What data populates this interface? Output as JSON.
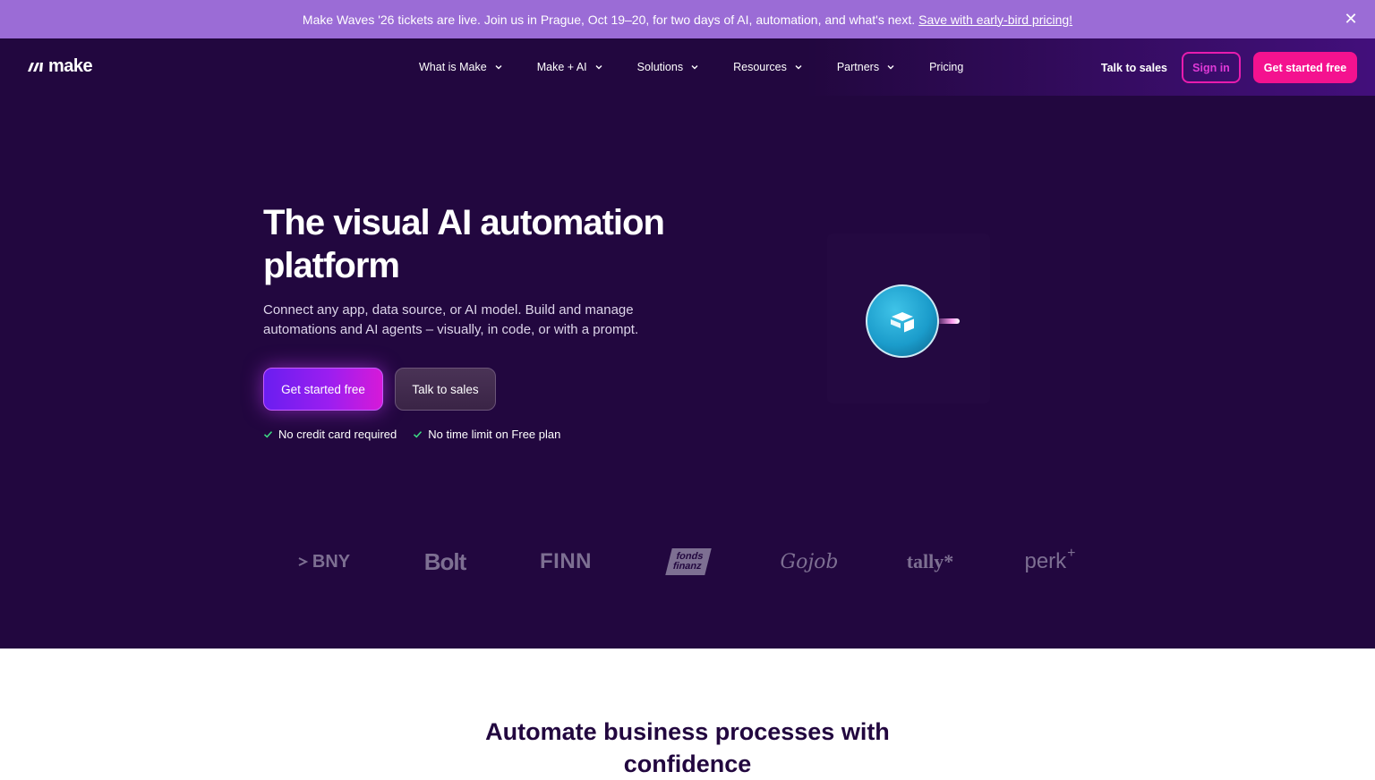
{
  "banner": {
    "text": "Make Waves '26 tickets are live. Join us in Prague, Oct 19–20, for two days of AI, automation, and what's next.",
    "link": "Save with early-bird pricing!",
    "close_icon": "close-icon"
  },
  "logo": {
    "text": "make",
    "icon": "make-logo-icon"
  },
  "nav": {
    "items": [
      {
        "label": "What is Make",
        "has_dropdown": true
      },
      {
        "label": "Make + AI",
        "has_dropdown": true
      },
      {
        "label": "Solutions",
        "has_dropdown": true
      },
      {
        "label": "Resources",
        "has_dropdown": true
      },
      {
        "label": "Partners",
        "has_dropdown": true
      },
      {
        "label": "Pricing",
        "has_dropdown": false
      }
    ],
    "talk_to_sales": "Talk to sales",
    "sign_in": "Sign in",
    "get_started": "Get started free"
  },
  "hero": {
    "title": "The visual AI automation platform",
    "subtitle": "Connect any app, data source, or AI model. Build and manage automations and AI agents – visually, in code, or with a prompt.",
    "primary_cta": "Get started free",
    "secondary_cta": "Talk to sales",
    "perks": [
      "No credit card required",
      "No time limit on Free plan"
    ]
  },
  "brands": [
    "BNY",
    "Bolt",
    "FINN",
    "fonds finanz",
    "Gojob",
    "tally*",
    "perk"
  ],
  "section": {
    "title_line1": "Automate business processes with",
    "title_line2": "confidence"
  },
  "colors": {
    "hero_bg": "#22073f",
    "banner_bg": "#9b6cd6",
    "accent_pink": "#f4128f",
    "brand_gray": "#7d6f92"
  }
}
